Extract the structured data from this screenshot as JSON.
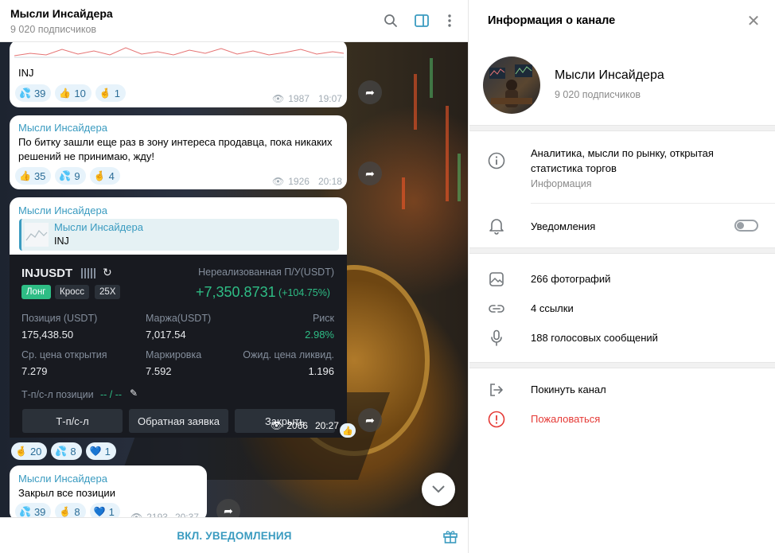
{
  "chat": {
    "title": "Мысли Инсайдера",
    "subscribers": "9 020 подписчиков",
    "messages": [
      {
        "text": "INJ",
        "reactions": [
          {
            "emoji": "💦",
            "count": "39"
          },
          {
            "emoji": "👍",
            "count": "10"
          },
          {
            "emoji": "🤞",
            "count": "1"
          }
        ],
        "views": "1987",
        "time": "19:07"
      },
      {
        "author": "Мысли Инсайдера",
        "text": "По битку зашли еще раз в зону интереса продавца, пока никаких решений не принимаю, жду!",
        "reactions": [
          {
            "emoji": "👍",
            "count": "35"
          },
          {
            "emoji": "💦",
            "count": "9"
          },
          {
            "emoji": "🤞",
            "count": "4"
          }
        ],
        "views": "1926",
        "time": "20:18"
      },
      {
        "author": "Мысли Инсайдера",
        "reply_author": "Мысли Инсайдера",
        "reply_text": "INJ",
        "views": "2066",
        "time": "20:27",
        "reactions": [
          {
            "emoji": "🤞",
            "count": "20"
          },
          {
            "emoji": "💦",
            "count": "8"
          },
          {
            "emoji": "💙",
            "count": "1"
          }
        ]
      },
      {
        "author": "Мысли Инсайдера",
        "text": "Закрыл все позиции",
        "reactions": [
          {
            "emoji": "💦",
            "count": "39"
          },
          {
            "emoji": "🤞",
            "count": "8"
          },
          {
            "emoji": "💙",
            "count": "1"
          }
        ],
        "views": "2193",
        "time": "20:37"
      }
    ],
    "trade_card": {
      "symbol": "INJUSDT",
      "pnl_label": "Нереализованная П/У(USDT)",
      "pnl_value": "+7,350.8731",
      "pnl_pct": "(+104.75%)",
      "tag_long": "Лонг",
      "tag_cross": "Кросс",
      "tag_leverage": "25X",
      "position_label": "Позиция (USDT)",
      "position_value": "175,438.50",
      "margin_label": "Маржа(USDT)",
      "margin_value": "7,017.54",
      "risk_label": "Риск",
      "risk_value": "2.98%",
      "entry_label": "Ср. цена открытия",
      "entry_value": "7.279",
      "mark_label": "Маркировка",
      "mark_value": "7.592",
      "liq_label": "Ожид. цена ликвид.",
      "liq_value": "1.196",
      "tpsl_label": "Т-п/с-л позиции",
      "tpsl_value": "-- / --",
      "btn_tpsl": "Т-п/с-л",
      "btn_reverse": "Обратная заявка",
      "btn_close": "Закрыть"
    },
    "bottom_button": "ВКЛ. УВЕДОМЛЕНИЯ"
  },
  "panel": {
    "title": "Информация о канале",
    "channel_name": "Мысли Инсайдера",
    "subscribers": "9 020 подписчиков",
    "description": "Аналитика, мысли по рынку, открытая статистика торгов",
    "description_label": "Информация",
    "notifications_label": "Уведомления",
    "photos": "266 фотографий",
    "links": "4 ссылки",
    "voice": "188 голосовых сообщений",
    "leave": "Покинуть канал",
    "report": "Пожаловаться",
    "report_color": "#e53935"
  }
}
